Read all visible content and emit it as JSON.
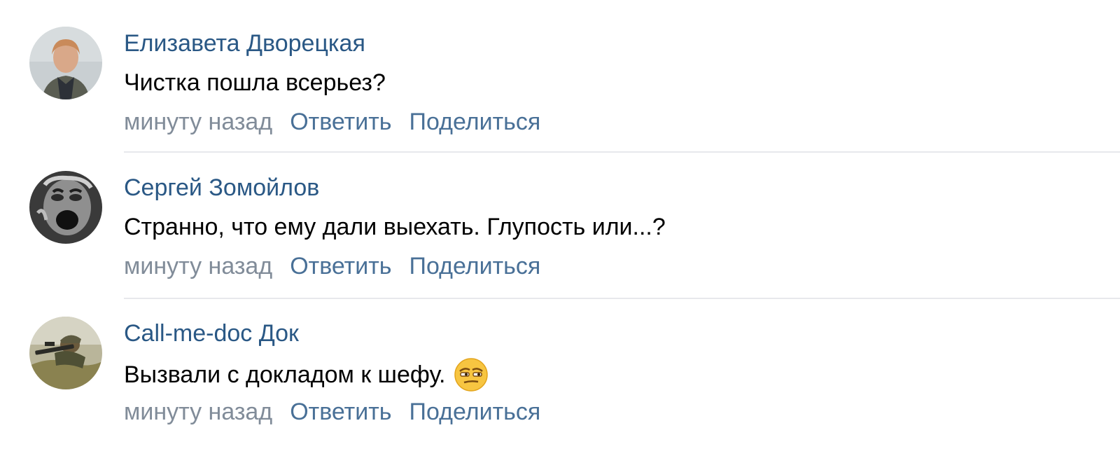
{
  "comments": [
    {
      "author": "Елизавета Дворецкая",
      "text": "Чистка пошла всерьез?",
      "time": "минуту назад",
      "reply_label": "Ответить",
      "share_label": "Поделиться",
      "avatar_icon": "woman-portrait-avatar"
    },
    {
      "author": "Сергей Зомойлов",
      "text": "Странно, что ему дали выехать. Глупость или...?",
      "time": "минуту назад",
      "reply_label": "Ответить",
      "share_label": "Поделиться",
      "avatar_icon": "screaming-face-avatar"
    },
    {
      "author": "Call-me-doc Док",
      "text": "Вызвали с докладом к шефу.",
      "time": "минуту назад",
      "reply_label": "Ответить",
      "share_label": "Поделиться",
      "avatar_icon": "soldier-with-rifle-avatar",
      "emoji_icon": "smirking-face-emoji"
    }
  ],
  "colors": {
    "author_link": "#2a5885",
    "meta_gray": "#818c99",
    "divider": "#e7e8ec",
    "text": "#000000"
  }
}
